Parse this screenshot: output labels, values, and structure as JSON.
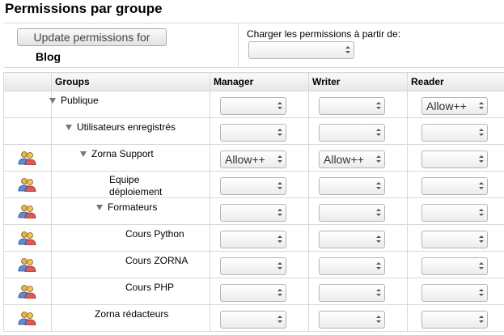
{
  "page": {
    "title": "Permissions par groupe",
    "update_button": "Update permissions for",
    "blog_name": "Blog",
    "load_label": "Charger les permissions à partir de:",
    "load_select": ""
  },
  "table": {
    "headers": {
      "icon": "",
      "groups": "Groups",
      "manager": "Manager",
      "writer": "Writer",
      "reader": "Reader"
    },
    "rows": [
      {
        "group": "Publique",
        "has_icon": false,
        "expanded": true,
        "manager": "",
        "writer": "",
        "reader": "Allow++"
      },
      {
        "group": "Utilisateurs enregistrés",
        "has_icon": false,
        "expanded": true,
        "manager": "",
        "writer": "",
        "reader": ""
      },
      {
        "group": "Zorna Support",
        "has_icon": true,
        "expanded": true,
        "manager": "Allow++",
        "writer": "Allow++",
        "reader": ""
      },
      {
        "group": "Equipe déploiement",
        "has_icon": true,
        "expanded": false,
        "manager": "",
        "writer": "",
        "reader": ""
      },
      {
        "group": "Formateurs",
        "has_icon": true,
        "expanded": true,
        "manager": "",
        "writer": "",
        "reader": ""
      },
      {
        "group": "Cours Python",
        "has_icon": true,
        "expanded": false,
        "manager": "",
        "writer": "",
        "reader": ""
      },
      {
        "group": "Cours ZORNA",
        "has_icon": true,
        "expanded": false,
        "manager": "",
        "writer": "",
        "reader": ""
      },
      {
        "group": "Cours PHP",
        "has_icon": true,
        "expanded": false,
        "manager": "",
        "writer": "",
        "reader": ""
      },
      {
        "group": "Zorna rédacteurs",
        "has_icon": true,
        "expanded": false,
        "manager": "",
        "writer": "",
        "reader": ""
      }
    ]
  },
  "colors": {
    "border": "#d8d8d8",
    "triangle": "#777777",
    "header_bg": "#e6e6e6"
  },
  "icons": {
    "group_row_icon": "users-icon",
    "expand_icon": "triangle-down-icon",
    "select_arrows": "updown-arrows-icon"
  }
}
